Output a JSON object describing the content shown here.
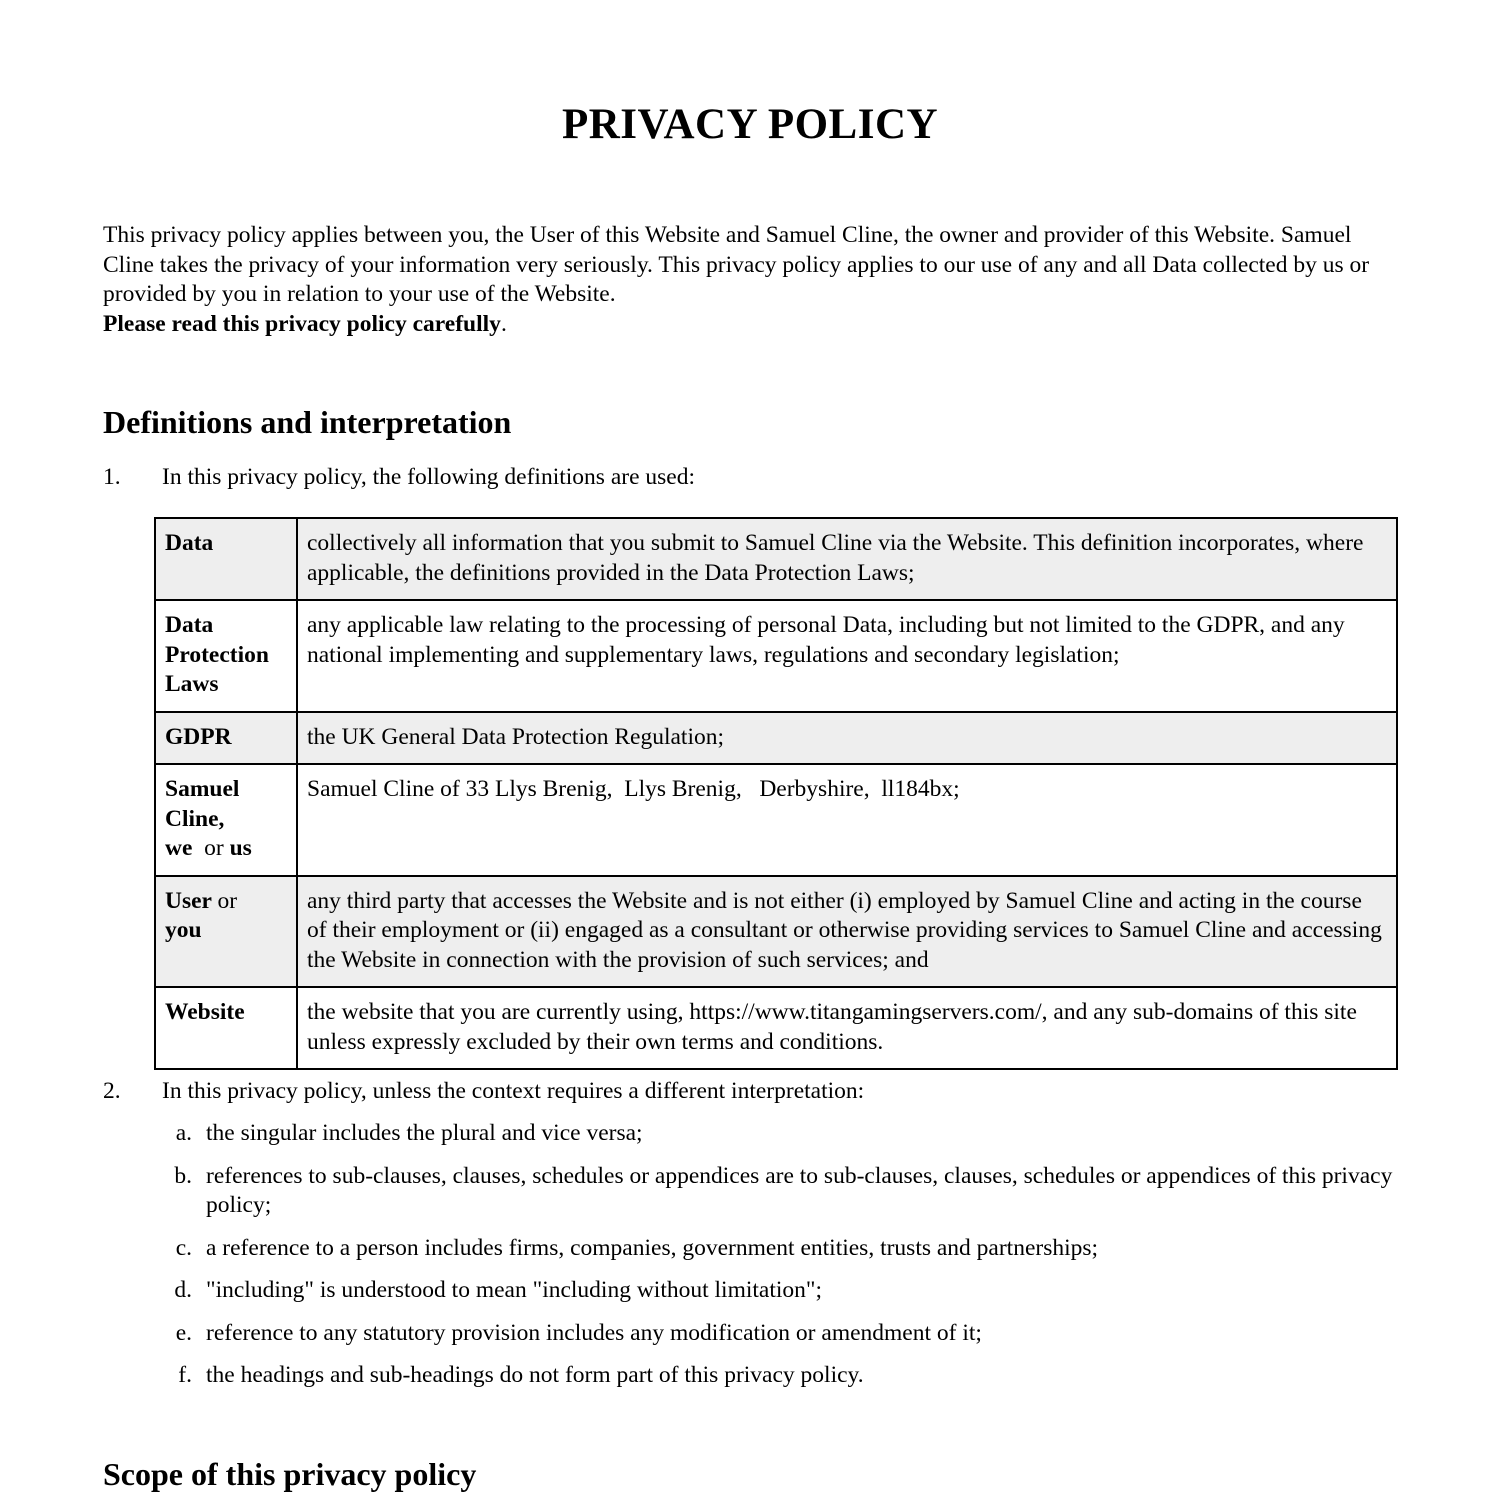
{
  "document": {
    "title": "PRIVACY POLICY",
    "intro": {
      "text": "This privacy policy applies between you, the User of this Website and Samuel Cline, the owner and provider of this Website. Samuel Cline takes the privacy of your information very seriously. This privacy policy applies to our use of any and all Data collected by us or provided by you in relation to your use of the Website.",
      "emphasis": "Please read this privacy policy carefully",
      "emphasis_suffix": "."
    },
    "sections": [
      {
        "heading": "Definitions and interpretation",
        "clauses": [
          {
            "number": "1.",
            "text": "In this privacy policy, the following definitions are used:"
          },
          {
            "number": "2.",
            "text": "In this privacy policy, unless the context requires a different interpretation:"
          }
        ]
      },
      {
        "heading": "Scope of this privacy policy"
      }
    ],
    "definitions": [
      {
        "term": "Data",
        "definition": "collectively all information that you submit to Samuel Cline via the Website. This definition incorporates, where applicable, the definitions provided in the Data Protection Laws;"
      },
      {
        "term": "Data Protection Laws",
        "definition": "any applicable law relating to the processing of personal Data, including but not limited to the GDPR, and any national implementing and supplementary laws, regulations and secondary legislation;"
      },
      {
        "term": "GDPR",
        "definition": "the UK General Data Protection Regulation;"
      },
      {
        "term_parts": [
          "Samuel Cline,",
          "we",
          "or",
          "us"
        ],
        "definition": "Samuel Cline of 33 Llys Brenig,  Llys Brenig,   Derbyshire,  ll184bx;"
      },
      {
        "term_parts": [
          "User",
          "or",
          "you"
        ],
        "definition": "any third party that accesses the Website and is not either (i) employed by Samuel Cline and acting in the course of their employment or (ii) engaged as a consultant or otherwise providing services to Samuel Cline and accessing the Website in connection with the provision of such services; and"
      },
      {
        "term": "Website",
        "definition": "the website that you are currently using, https://www.titangamingservers.com/, and any sub-domains of this site unless expressly excluded by their own terms and conditions."
      }
    ],
    "interpretation_items": [
      {
        "letter": "a.",
        "text": "the singular includes the plural and vice versa;"
      },
      {
        "letter": "b.",
        "text": "references to sub-clauses, clauses, schedules or appendices are to sub-clauses, clauses, schedules or appendices of this privacy policy;"
      },
      {
        "letter": "c.",
        "text": "a reference to a person includes firms, companies, government entities, trusts and partnerships;"
      },
      {
        "letter": "d.",
        "text": "\"including\" is understood to mean \"including without limitation\";"
      },
      {
        "letter": "e.",
        "text": "reference to any statutory provision includes any modification or amendment of it;"
      },
      {
        "letter": "f.",
        "text": "the headings and sub-headings do not form part of this privacy policy."
      }
    ]
  }
}
